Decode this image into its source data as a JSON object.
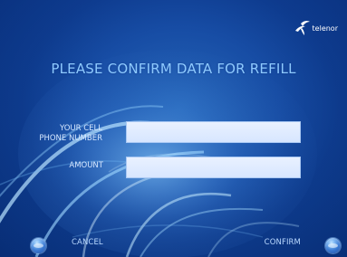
{
  "brand": {
    "name": "telenor"
  },
  "screen": {
    "title": "PLEASE CONFIRM DATA FOR REFILL"
  },
  "fields": {
    "phone": {
      "label": "YOUR CELL\nPHONE NUMBER",
      "value": ""
    },
    "amount": {
      "label": "AMOUNT",
      "value": ""
    }
  },
  "actions": {
    "cancel_label": "CANCEL",
    "confirm_label": "CONFIRM"
  },
  "icons": {
    "logo": "telenor-logo-icon",
    "left_button": "round-button-icon",
    "right_button": "round-button-icon"
  },
  "colors": {
    "background_dark": "#082f7b",
    "background_mid": "#1b56b3",
    "background_light": "#2f78cf",
    "title": "#8ecaff",
    "field_fill": "#d7e6ff"
  }
}
